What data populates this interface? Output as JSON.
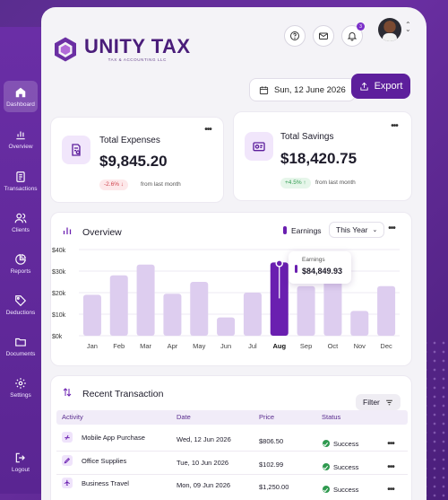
{
  "brand": {
    "name": "UNITY TAX",
    "tagline": "TAX & ACCOUNTING LLC"
  },
  "colors": {
    "accent": "#5d1f9c",
    "bar": "#ddcdef",
    "bar_active": "#6a1fb0",
    "success": "#2f9a4f",
    "danger": "#d0454f"
  },
  "sidebar": {
    "items": [
      {
        "label": "Dashboard",
        "icon": "home-icon",
        "active": true
      },
      {
        "label": "Overview",
        "icon": "bar-chart-icon"
      },
      {
        "label": "Transactions",
        "icon": "document-icon"
      },
      {
        "label": "Clients",
        "icon": "users-icon"
      },
      {
        "label": "Reports",
        "icon": "pie-chart-icon"
      },
      {
        "label": "Deductions",
        "icon": "tag-icon"
      },
      {
        "label": "Documents",
        "icon": "folder-icon"
      },
      {
        "label": "Settings",
        "icon": "gear-icon"
      },
      {
        "label": "Logout",
        "icon": "logout-icon"
      }
    ]
  },
  "header": {
    "notification_count": "3"
  },
  "toolbar": {
    "date": "Sun, 12 June 2026",
    "export_label": "Export"
  },
  "stats": {
    "expenses": {
      "title": "Total Expenses",
      "value": "$9,845.20",
      "change": "-2.6% ↓",
      "note": "from last month"
    },
    "savings": {
      "title": "Total Savings",
      "value": "$18,420.75",
      "change": "+4.5% ↑",
      "note": "from last month"
    }
  },
  "overview": {
    "title": "Overview",
    "legend": "Earnings",
    "period": "This Year",
    "tooltip": {
      "label": "Earnings",
      "value": "$84,849.93"
    }
  },
  "chart_data": {
    "type": "bar",
    "categories": [
      "Jan",
      "Feb",
      "Mar",
      "Apr",
      "May",
      "Jun",
      "Jul",
      "Aug",
      "Sep",
      "Oct",
      "Nov",
      "Dec"
    ],
    "series": [
      {
        "name": "Earnings",
        "values": [
          19000,
          28000,
          33000,
          19500,
          25000,
          8500,
          20000,
          34000,
          23000,
          27500,
          11500,
          23000
        ]
      }
    ],
    "y_ticks": [
      "$0k",
      "$10k",
      "$20k",
      "$30k",
      "$40k"
    ],
    "ylim": [
      0,
      40000
    ],
    "highlight": "Aug",
    "grid": true
  },
  "transactions": {
    "title": "Recent Transaction",
    "filter_label": "Filter",
    "columns": [
      "Activity",
      "Date",
      "Price",
      "Status"
    ],
    "rows": [
      {
        "activity": "Mobile App Purchase",
        "icon": "app-store-icon",
        "date": "Wed, 12 Jun 2026",
        "price": "$806.50",
        "status": "Success"
      },
      {
        "activity": "Office Supplies",
        "icon": "pen-icon",
        "date": "Tue, 10 Jun 2026",
        "price": "$102.99",
        "status": "Success"
      },
      {
        "activity": "Business Travel",
        "icon": "plane-icon",
        "date": "Mon, 09 Jun 2026",
        "price": "$1,250.00",
        "status": "Success"
      }
    ]
  }
}
